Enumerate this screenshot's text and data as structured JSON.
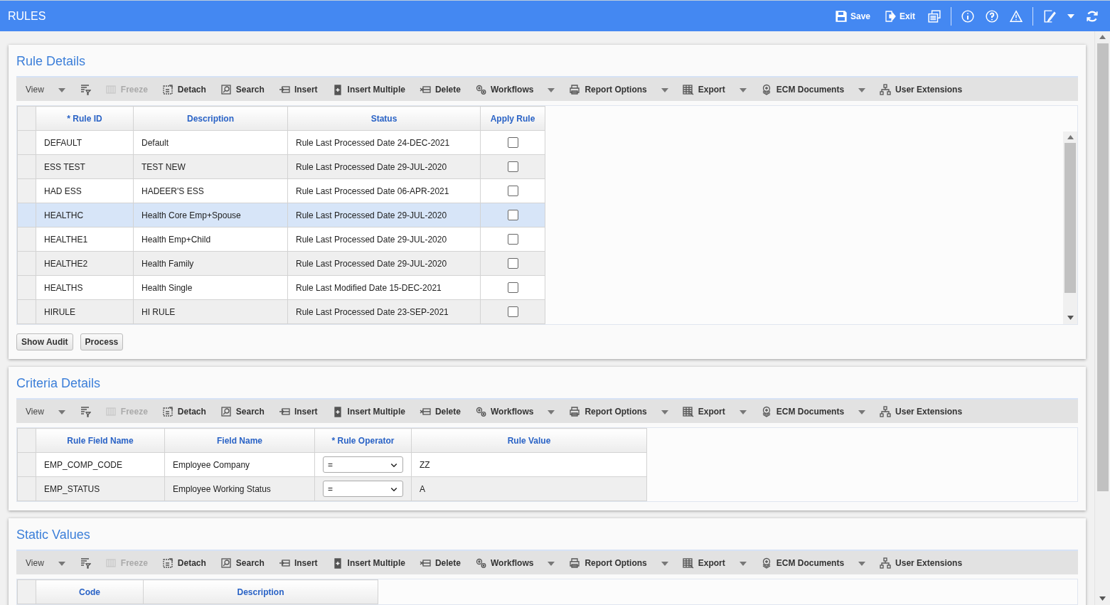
{
  "header": {
    "title": "RULES",
    "actions": [
      "Save",
      "Exit"
    ]
  },
  "sections": [
    {
      "title": "Rule Details",
      "toolbar": [
        {
          "kind": "view",
          "label": "View",
          "disabled": false,
          "dropdown": true
        },
        {
          "kind": "filter",
          "disabled": false,
          "dropdown": false
        },
        {
          "kind": "freeze",
          "label": "Freeze",
          "disabled": true,
          "dropdown": false
        },
        {
          "kind": "detach",
          "label": "Detach",
          "disabled": false,
          "dropdown": false
        },
        {
          "kind": "search",
          "label": "Search",
          "disabled": false,
          "dropdown": false
        },
        {
          "kind": "insert",
          "label": "Insert",
          "disabled": false,
          "dropdown": false
        },
        {
          "kind": "multiple",
          "label": "Insert Multiple",
          "disabled": false,
          "dropdown": false
        },
        {
          "kind": "delete",
          "label": "Delete",
          "disabled": false,
          "dropdown": false
        },
        {
          "kind": "workflows",
          "label": "Workflows",
          "disabled": false,
          "dropdown": true
        },
        {
          "kind": "report",
          "label": "Report Options",
          "disabled": false,
          "dropdown": true
        },
        {
          "kind": "export",
          "label": "Export",
          "disabled": false,
          "dropdown": true
        },
        {
          "kind": "ecm",
          "label": "ECM Documents",
          "disabled": false,
          "dropdown": true
        },
        {
          "kind": "extensions",
          "label": "User Extensions",
          "disabled": false,
          "dropdown": false
        }
      ],
      "columns": [
        {
          "label": "* Rule ID",
          "kind": "text"
        },
        {
          "label": "Description",
          "kind": "text"
        },
        {
          "label": "Status",
          "kind": "text"
        },
        {
          "label": "Apply Rule",
          "kind": "check"
        }
      ],
      "rows": [
        {
          "selected": false,
          "cells": [
            "DEFAULT",
            "Default",
            "Rule Last Processed Date 24-DEC-2021",
            false
          ]
        },
        {
          "selected": false,
          "cells": [
            "ESS TEST",
            "TEST NEW",
            "Rule Last Processed Date 29-JUL-2020",
            false
          ]
        },
        {
          "selected": false,
          "cells": [
            "HAD ESS",
            "HADEER'S ESS",
            "Rule Last Processed Date 06-APR-2021",
            false
          ]
        },
        {
          "selected": true,
          "cells": [
            "HEALTHC",
            "Health Core Emp+Spouse",
            "Rule Last Processed Date 29-JUL-2020",
            false
          ]
        },
        {
          "selected": false,
          "cells": [
            "HEALTHE1",
            "Health Emp+Child",
            "Rule Last Processed Date 29-JUL-2020",
            false
          ]
        },
        {
          "selected": false,
          "cells": [
            "HEALTHE2",
            "Health Family",
            "Rule Last Processed Date 29-JUL-2020",
            false
          ]
        },
        {
          "selected": false,
          "cells": [
            "HEALTHS",
            "Health Single",
            "Rule Last Modified Date 15-DEC-2021",
            false
          ]
        },
        {
          "selected": false,
          "cells": [
            "HIRULE",
            "HI RULE",
            "Rule Last Processed Date 23-SEP-2021",
            false
          ]
        }
      ],
      "buttons": [
        "Show Audit",
        "Process"
      ]
    },
    {
      "title": "Criteria Details",
      "toolbar": [
        {
          "kind": "view",
          "label": "View",
          "disabled": false,
          "dropdown": true
        },
        {
          "kind": "filter",
          "disabled": false,
          "dropdown": false
        },
        {
          "kind": "freeze",
          "label": "Freeze",
          "disabled": true,
          "dropdown": false
        },
        {
          "kind": "detach",
          "label": "Detach",
          "disabled": false,
          "dropdown": false
        },
        {
          "kind": "search",
          "label": "Search",
          "disabled": false,
          "dropdown": false
        },
        {
          "kind": "insert",
          "label": "Insert",
          "disabled": false,
          "dropdown": false
        },
        {
          "kind": "multiple",
          "label": "Insert Multiple",
          "disabled": false,
          "dropdown": false
        },
        {
          "kind": "delete",
          "label": "Delete",
          "disabled": false,
          "dropdown": false
        },
        {
          "kind": "workflows",
          "label": "Workflows",
          "disabled": false,
          "dropdown": true
        },
        {
          "kind": "report",
          "label": "Report Options",
          "disabled": false,
          "dropdown": true
        },
        {
          "kind": "export",
          "label": "Export",
          "disabled": false,
          "dropdown": true
        },
        {
          "kind": "ecm",
          "label": "ECM Documents",
          "disabled": false,
          "dropdown": true
        },
        {
          "kind": "extensions",
          "label": "User Extensions",
          "disabled": false,
          "dropdown": false
        }
      ],
      "columns": [
        {
          "label": "Rule Field Name",
          "kind": "text"
        },
        {
          "label": "Field Name",
          "kind": "text"
        },
        {
          "label": "* Rule Operator",
          "kind": "select"
        },
        {
          "label": "Rule Value",
          "kind": "text"
        }
      ],
      "rows": [
        {
          "selected": false,
          "cells": [
            "EMP_COMP_CODE",
            "Employee Company",
            "=",
            "ZZ"
          ]
        },
        {
          "selected": false,
          "cells": [
            "EMP_STATUS",
            "Employee Working Status",
            "=",
            "A"
          ]
        }
      ]
    },
    {
      "title": "Static Values",
      "toolbar": [
        {
          "kind": "view",
          "label": "View",
          "disabled": false,
          "dropdown": true
        },
        {
          "kind": "filter",
          "disabled": false,
          "dropdown": false
        },
        {
          "kind": "freeze",
          "label": "Freeze",
          "disabled": true,
          "dropdown": false
        },
        {
          "kind": "detach",
          "label": "Detach",
          "disabled": false,
          "dropdown": false
        },
        {
          "kind": "search",
          "label": "Search",
          "disabled": false,
          "dropdown": false
        },
        {
          "kind": "insert",
          "label": "Insert",
          "disabled": false,
          "dropdown": false
        },
        {
          "kind": "multiple",
          "label": "Insert Multiple",
          "disabled": false,
          "dropdown": false
        },
        {
          "kind": "delete",
          "label": "Delete",
          "disabled": false,
          "dropdown": false
        },
        {
          "kind": "workflows",
          "label": "Workflows",
          "disabled": false,
          "dropdown": true
        },
        {
          "kind": "report",
          "label": "Report Options",
          "disabled": false,
          "dropdown": true
        },
        {
          "kind": "export",
          "label": "Export",
          "disabled": false,
          "dropdown": true
        },
        {
          "kind": "ecm",
          "label": "ECM Documents",
          "disabled": false,
          "dropdown": true
        },
        {
          "kind": "extensions",
          "label": "User Extensions",
          "disabled": false,
          "dropdown": false
        }
      ],
      "columns": [
        {
          "label": "Code"
        },
        {
          "label": "Description"
        }
      ]
    }
  ]
}
